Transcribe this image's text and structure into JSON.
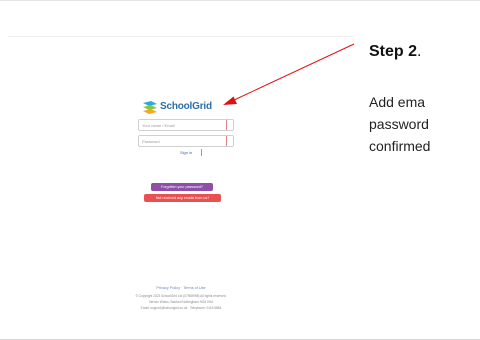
{
  "screenshot": {
    "brand": "SchoolGrid",
    "email_placeholder": "Your name / Email",
    "password_placeholder": "Password",
    "sign_in_label": "Sign in",
    "forgot_button_label": "Forgotten your password?",
    "register_button_label": "Not received any emails from us?",
    "footer_links": "Privacy Policy  ·  Terms of Use",
    "footer_lines": [
      "© Copyright 2023 SchoolGrid Ltd (07908998) All rights reserved.",
      "Vernon Works, Basford Nottingham NG6 0HA",
      "Email: support@schoolgrid.co.uk  ·  Telephone: 0115 8884"
    ]
  },
  "annotation": {
    "title_bold": "Step 2",
    "title_suffix": ".",
    "body_lines": [
      "Add ema",
      "password",
      "confirmed"
    ]
  },
  "colors": {
    "arrow": "#e01010",
    "brand_blue": "#2b6fa8",
    "forgot_purple": "#8f4fa8",
    "register_red": "#e8514f"
  }
}
